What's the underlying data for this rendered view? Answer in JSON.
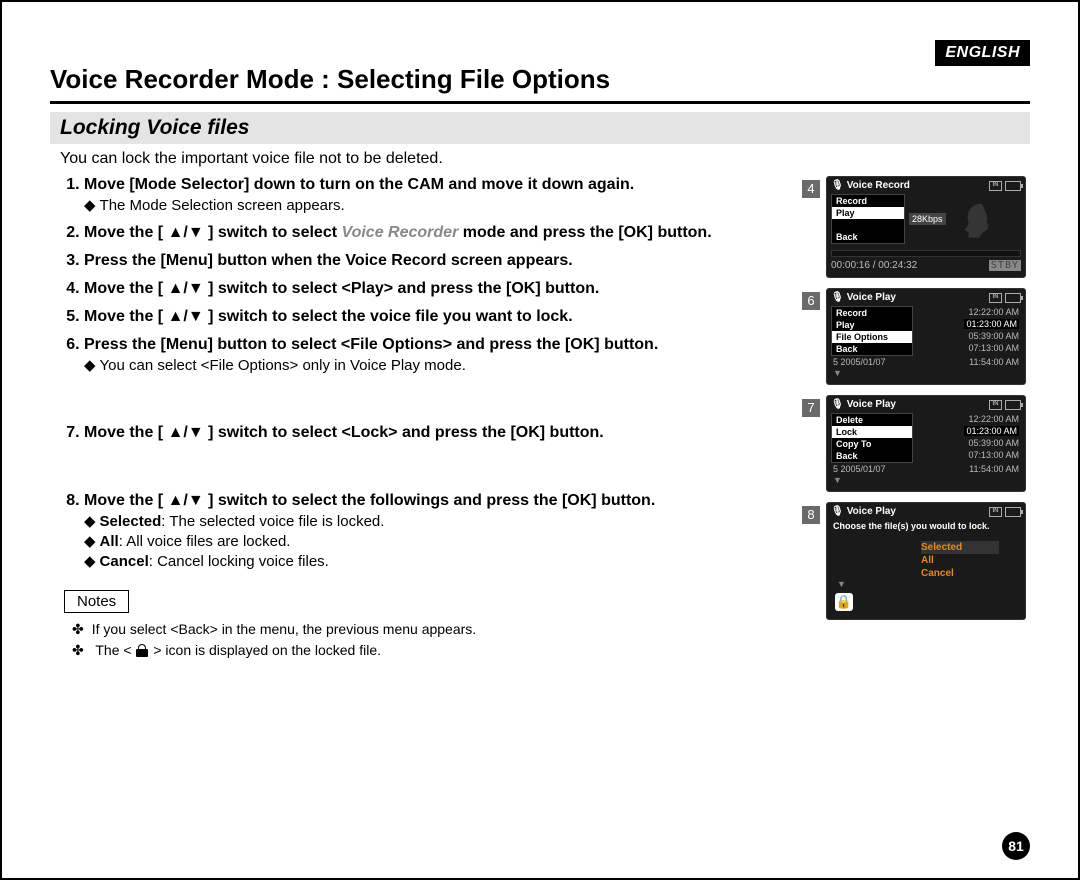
{
  "lang": "ENGLISH",
  "title": "Voice Recorder Mode : Selecting File Options",
  "subtitle": "Locking Voice files",
  "intro": "You can lock the important voice file not to be deleted.",
  "steps": {
    "s1": {
      "text_a": "Move [Mode Selector] down to turn on the CAM and move it down again.",
      "sub": "The Mode Selection screen appears."
    },
    "s2": {
      "pre": "Move the [ ▲/▼ ] switch to select ",
      "mode": "Voice Recorder",
      "post": " mode and press the [OK] button."
    },
    "s3": {
      "text": "Press the [Menu] button when the Voice Record screen appears."
    },
    "s4": {
      "text": "Move the [ ▲/▼ ] switch to select <Play> and press the [OK] button."
    },
    "s5": {
      "text": "Move the [ ▲/▼ ] switch to select the voice file you want to lock."
    },
    "s6": {
      "text": "Press the [Menu] button to select <File Options> and press the [OK] button.",
      "sub": "You can select <File Options> only in Voice Play mode."
    },
    "s7": {
      "text": "Move the [ ▲/▼ ] switch to select <Lock> and press the [OK] button."
    },
    "s8": {
      "text": "Move the [ ▲/▼ ] switch to select the followings and press the [OK] button.",
      "opt1_l": "Selected",
      "opt1_t": ": The selected voice file is locked.",
      "opt2_l": "All",
      "opt2_t": ": All voice files are locked.",
      "opt3_l": "Cancel",
      "opt3_t": ": Cancel locking voice files."
    }
  },
  "notes_label": "Notes",
  "notes": {
    "n1": "If you select <Back> in the menu, the previous menu appears.",
    "n2_pre": "The < ",
    "n2_post": " > icon is displayed on the locked file."
  },
  "thumbs": {
    "t4": {
      "num": "4",
      "title": "Voice Record",
      "m1": "Record",
      "m2": "Play",
      "m3": "Back",
      "kbps": "28Kbps",
      "time": "00:00:16 / 00:24:32",
      "stby": "STBY"
    },
    "t6": {
      "num": "6",
      "title": "Voice Play",
      "m1": "Record",
      "m2": "Play",
      "m3": "File Options",
      "m4": "Back",
      "r1t": "12:22:00 AM",
      "r2t": "01:23:00 AM",
      "r3t": "05:39:00 AM",
      "r4t": "07:13:00 AM",
      "r5": "5  2005/01/07",
      "r5t": "11:54:00 AM"
    },
    "t7": {
      "num": "7",
      "title": "Voice Play",
      "m1": "Delete",
      "m2": "Lock",
      "m3": "Copy To",
      "m4": "Back",
      "r1t": "12:22:00 AM",
      "r2t": "01:23:00 AM",
      "r3t": "05:39:00 AM",
      "r4t": "07:13:00 AM",
      "r5": "5  2005/01/07",
      "r5t": "11:54:00 AM"
    },
    "t8": {
      "num": "8",
      "title": "Voice Play",
      "prompt": "Choose the file(s) you would to lock.",
      "o1": "Selected",
      "o2": "All",
      "o3": "Cancel"
    }
  },
  "page_number": "81"
}
